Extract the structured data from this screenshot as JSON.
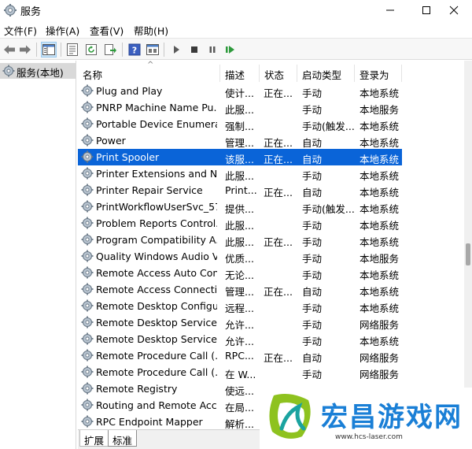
{
  "window": {
    "title": "服务"
  },
  "menu": [
    {
      "label": "文件(F)"
    },
    {
      "label": "操作(A)"
    },
    {
      "label": "查看(V)"
    },
    {
      "label": "帮助(H)"
    }
  ],
  "toolbar": {
    "icons": [
      "back-arrow-icon",
      "forward-arrow-icon",
      "show-tree-icon",
      "properties-icon",
      "refresh-icon",
      "export-list-icon",
      "help-icon",
      "console-view-icon",
      "start-service-icon",
      "stop-service-icon",
      "pause-service-icon",
      "restart-service-icon"
    ]
  },
  "tree": {
    "root_label": "服务(本地)"
  },
  "columns": {
    "name": "名称",
    "desc": "描述",
    "status": "状态",
    "startup": "启动类型",
    "logon": "登录为"
  },
  "services": [
    {
      "name": "Plug and Play",
      "desc": "使计...",
      "status": "正在...",
      "startup": "手动",
      "logon": "本地系统"
    },
    {
      "name": "PNRP Machine Name Pu...",
      "desc": "此服...",
      "status": "",
      "startup": "手动",
      "logon": "本地服务"
    },
    {
      "name": "Portable Device Enumera...",
      "desc": "强制...",
      "status": "",
      "startup": "手动(触发...",
      "logon": "本地系统"
    },
    {
      "name": "Power",
      "desc": "管理...",
      "status": "正在...",
      "startup": "自动",
      "logon": "本地系统"
    },
    {
      "name": "Print Spooler",
      "desc": "该服...",
      "status": "正在...",
      "startup": "自动",
      "logon": "本地系统"
    },
    {
      "name": "Printer Extensions and N...",
      "desc": "此服...",
      "status": "",
      "startup": "手动",
      "logon": "本地系统"
    },
    {
      "name": "Printer Repair Service",
      "desc": "Print...",
      "status": "正在...",
      "startup": "自动",
      "logon": "本地系统"
    },
    {
      "name": "PrintWorkflowUserSvc_57...",
      "desc": "提供...",
      "status": "",
      "startup": "手动(触发...",
      "logon": "本地系统"
    },
    {
      "name": "Problem Reports Control...",
      "desc": "此服...",
      "status": "",
      "startup": "手动",
      "logon": "本地系统"
    },
    {
      "name": "Program Compatibility A...",
      "desc": "此服...",
      "status": "正在...",
      "startup": "手动",
      "logon": "本地系统"
    },
    {
      "name": "Quality Windows Audio V...",
      "desc": "优质...",
      "status": "",
      "startup": "手动",
      "logon": "本地服务"
    },
    {
      "name": "Remote Access Auto Con...",
      "desc": "无论...",
      "status": "",
      "startup": "手动",
      "logon": "本地系统"
    },
    {
      "name": "Remote Access Connecti...",
      "desc": "管理...",
      "status": "正在...",
      "startup": "自动",
      "logon": "本地系统"
    },
    {
      "name": "Remote Desktop Configu...",
      "desc": "远程...",
      "status": "",
      "startup": "手动",
      "logon": "本地系统"
    },
    {
      "name": "Remote Desktop Services",
      "desc": "允许...",
      "status": "",
      "startup": "手动",
      "logon": "网络服务"
    },
    {
      "name": "Remote Desktop Service...",
      "desc": "允许...",
      "status": "",
      "startup": "手动",
      "logon": "本地系统"
    },
    {
      "name": "Remote Procedure Call (...",
      "desc": "RPC...",
      "status": "正在...",
      "startup": "自动",
      "logon": "网络服务"
    },
    {
      "name": "Remote Procedure Call (...",
      "desc": "在 W...",
      "status": "",
      "startup": "手动",
      "logon": "网络服务"
    },
    {
      "name": "Remote Registry",
      "desc": "使远...",
      "status": "",
      "startup": "",
      "logon": ""
    },
    {
      "name": "Routing and Remote Acc...",
      "desc": "在局...",
      "status": "",
      "startup": "",
      "logon": ""
    },
    {
      "name": "RPC Endpoint Mapper",
      "desc": "解析...",
      "status": "",
      "startup": "",
      "logon": ""
    }
  ],
  "tabs": [
    {
      "label": "扩展"
    },
    {
      "label": "标准"
    }
  ],
  "ad": {
    "text": "宏昌游戏网",
    "url": "www.hcs-laser.com"
  },
  "colors": {
    "selected_row": "#0a64d8",
    "toolbar_bg": "#f7f7f7",
    "ad_text": "#1a7fd6"
  }
}
